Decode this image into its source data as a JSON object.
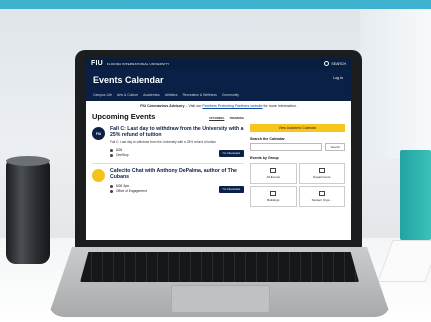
{
  "site": {
    "logo": "FIU",
    "university": "FLORIDA INTERNATIONAL UNIVERSITY",
    "search_label": "SEARCH"
  },
  "calendar": {
    "title": "Events Calendar",
    "login": "Log In",
    "nav": [
      "Campus Life",
      "Arts & Culture",
      "Academics",
      "Athletics",
      "Recreation & Wellness",
      "Community"
    ]
  },
  "advisory": {
    "bold": "FIU Coronavirus Advisory",
    "text_before": " – Visit our ",
    "link": "Panthers Protecting Panthers website",
    "text_after": " for more information."
  },
  "upcoming": {
    "title": "Upcoming Events",
    "tabs": [
      "UPCOMING",
      "TRENDING"
    ]
  },
  "events": [
    {
      "icon_text": "FIU",
      "title": "Fall C: Last day to withdraw from the University with a 25% refund of tuition",
      "desc": "Fall C: Last day to withdraw from the University with a 25% refund of tuition",
      "date": "8/28",
      "location": "OneStop",
      "button": "I'm Interested"
    },
    {
      "title": "Cafecito Chat with Anthony DePalma, author of The Cubans",
      "date": "8/28 3pm",
      "location": "Office of Engagement",
      "button": "I'm Interested"
    }
  ],
  "sidebar": {
    "view_calendar": "View Academic Calendar",
    "search_label": "Search the Calendar",
    "search_button": "Search",
    "groups_label": "Events by Group",
    "groups": [
      "All Events",
      "Departments",
      "Buildings",
      "Student Orgs..."
    ]
  }
}
